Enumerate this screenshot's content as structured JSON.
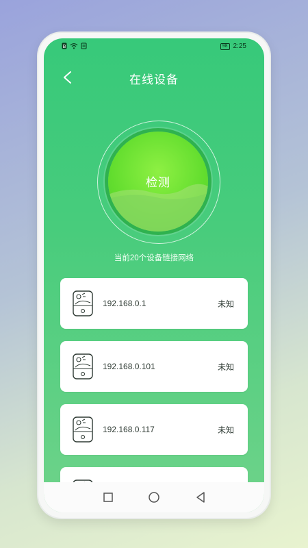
{
  "status_bar": {
    "time": "2:25",
    "battery": "98"
  },
  "header": {
    "title": "在线设备"
  },
  "scan": {
    "label": "检测",
    "summary": "当前20个设备链接网络"
  },
  "devices": [
    {
      "ip": "192.168.0.1",
      "status": "未知"
    },
    {
      "ip": "192.168.0.101",
      "status": "未知"
    },
    {
      "ip": "192.168.0.117",
      "status": "未知"
    },
    {
      "ip": "",
      "status": ""
    }
  ],
  "colors": {
    "accent": "#37c97a",
    "ball": "#62dd2e",
    "card_bg": "#ffffff"
  },
  "icons": [
    "back-arrow-icon",
    "device-icon",
    "square-nav-icon",
    "circle-nav-icon",
    "triangle-nav-icon"
  ]
}
